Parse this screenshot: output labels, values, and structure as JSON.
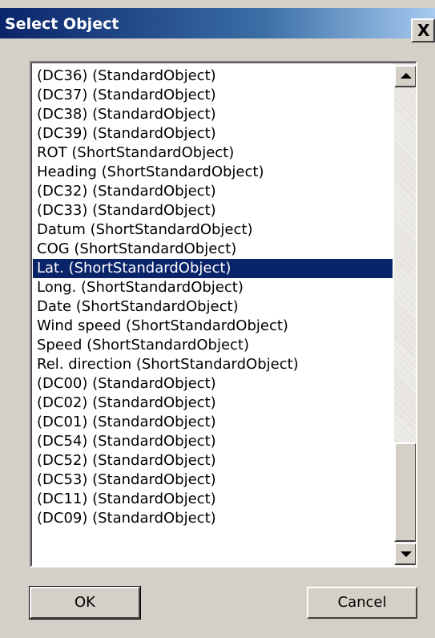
{
  "window": {
    "title": "Select Object",
    "close_glyph": "X"
  },
  "list": {
    "items": [
      "(DC36)  (StandardObject)",
      "(DC37)  (StandardObject)",
      "(DC38)  (StandardObject)",
      "(DC39)  (StandardObject)",
      "ROT (ShortStandardObject)",
      "Heading (ShortStandardObject)",
      "(DC32)  (StandardObject)",
      "(DC33)  (StandardObject)",
      "Datum (ShortStandardObject)",
      "COG (ShortStandardObject)",
      "Lat. (ShortStandardObject)",
      "Long. (ShortStandardObject)",
      "Date (ShortStandardObject)",
      "Wind speed (ShortStandardObject)",
      "Speed (ShortStandardObject)",
      "Rel. direction (ShortStandardObject)",
      "(DC00)  (StandardObject)",
      "(DC02)  (StandardObject)",
      "(DC01)  (StandardObject)",
      "(DC54)  (StandardObject)",
      "(DC52)  (StandardObject)",
      "(DC53)  (StandardObject)",
      "(DC11)  (StandardObject)",
      "(DC09)  (StandardObject)"
    ],
    "selected_item": "Lat. (ShortStandardObject)"
  },
  "buttons": {
    "ok_label": "OK",
    "cancel_label": "Cancel"
  },
  "colors": {
    "selection_bg": "#0a246a",
    "titlebar_start": "#0a246a",
    "face": "#d4d0c8"
  },
  "icons": {
    "scroll_up": "scroll-up-arrow-icon",
    "scroll_down": "scroll-down-arrow-icon",
    "close": "close-icon"
  }
}
